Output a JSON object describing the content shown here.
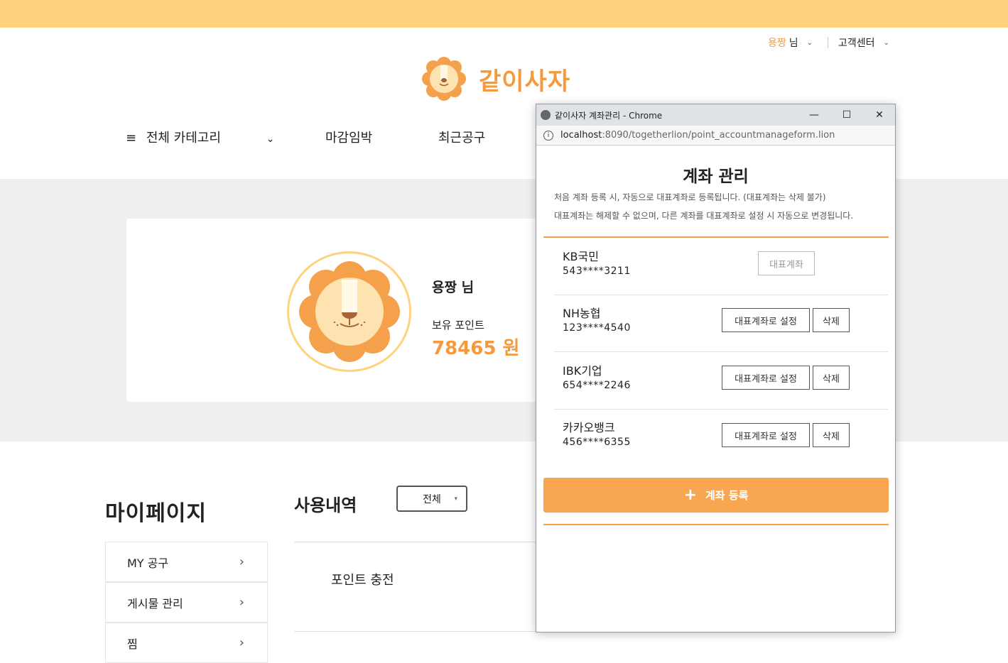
{
  "header": {
    "user_name": "용짱",
    "user_suffix": "님",
    "customer_center": "고객센터",
    "logo_text": "같이사자"
  },
  "nav": {
    "all_categories": "전체 카테고리",
    "closing_soon": "마감임박",
    "recent_group": "최근공구"
  },
  "profile": {
    "name": "용짱 님",
    "points_label": "보유 포인트",
    "points_value": "78465 원"
  },
  "mypage": {
    "title": "마이페이지",
    "menu": [
      "MY 공구",
      "게시물 관리",
      "찜"
    ]
  },
  "usage": {
    "title": "사용내역",
    "filter": "전체",
    "row1": "포인트 충전"
  },
  "popup": {
    "window_title": "같이사자 계좌관리 - Chrome",
    "url_host": "localhost",
    "url_path": ":8090/togetherlion/point_accountmanageform.lion",
    "title": "계좌 관리",
    "desc1": "처음 계좌 등록 시, 자동으로 대표계좌로 등록됩니다. (대표계좌는 삭제 불가)",
    "desc2": "대표계좌는 해제할 수 없으며, 다른 계좌를 대표계좌로 설정 시 자동으로 변경됩니다.",
    "primary_label": "대표계좌",
    "set_primary_label": "대표계좌로 설정",
    "delete_label": "삭제",
    "register_label": "계좌 등록",
    "accounts": [
      {
        "bank": "KB국민",
        "number": "543****3211"
      },
      {
        "bank": "NH농협",
        "number": "123****4540"
      },
      {
        "bank": "IBK기업",
        "number": "654****2246"
      },
      {
        "bank": "카카오뱅크",
        "number": "456****6355"
      }
    ]
  },
  "colors": {
    "accent": "#f5993c",
    "topbar": "#ffd37e",
    "button": "#f9a650"
  }
}
